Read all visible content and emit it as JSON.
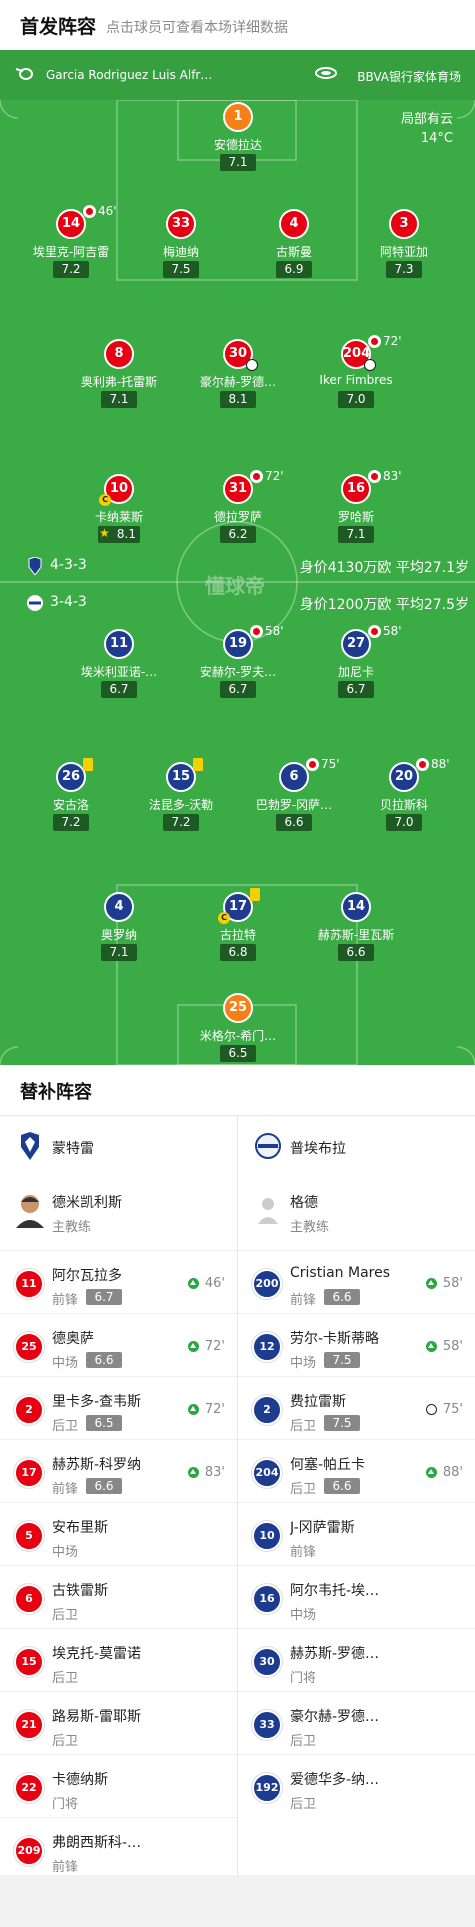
{
  "header": {
    "title": "首发阵容",
    "subtitle": "点击球员可查看本场详细数据"
  },
  "pitch": {
    "referee": "Garcia Rodriguez Luis Alfr…",
    "stadium": "BBVA银行家体育场",
    "weather": "局部有云",
    "temperature": "14°C",
    "watermark": "懂球帝"
  },
  "home_team": {
    "formation": "4-3-3",
    "value": "身价4130万欧 平均27.1岁"
  },
  "away_team": {
    "formation": "3-4-3",
    "value": "身价1200万欧 平均27.5岁"
  },
  "home_players": [
    {
      "num": "1",
      "name": "安德拉达",
      "rating": "7.1",
      "color": "orange"
    },
    {
      "num": "14",
      "name": "埃里克-阿吉雷",
      "rating": "7.2",
      "sub": "46'"
    },
    {
      "num": "33",
      "name": "梅迪纳",
      "rating": "7.5"
    },
    {
      "num": "4",
      "name": "古斯曼",
      "rating": "6.9"
    },
    {
      "num": "3",
      "name": "阿特亚加",
      "rating": "7.3"
    },
    {
      "num": "8",
      "name": "奥利弗-托雷斯",
      "rating": "7.1"
    },
    {
      "num": "30",
      "name": "豪尔赫-罗德…",
      "rating": "8.1"
    },
    {
      "num": "204",
      "name": "Iker Fimbres",
      "rating": "7.0",
      "sub": "72'"
    },
    {
      "num": "10",
      "name": "卡纳莱斯",
      "rating": "8.1"
    },
    {
      "num": "31",
      "name": "德拉罗萨",
      "rating": "6.2",
      "sub": "72'"
    },
    {
      "num": "16",
      "name": "罗哈斯",
      "rating": "7.1",
      "sub": "83'"
    }
  ],
  "away_players": [
    {
      "num": "11",
      "name": "埃米利亚诺-…",
      "rating": "6.7"
    },
    {
      "num": "19",
      "name": "安赫尔-罗夫…",
      "rating": "6.7",
      "sub": "58'"
    },
    {
      "num": "27",
      "name": "加尼卡",
      "rating": "6.7",
      "sub": "58'"
    },
    {
      "num": "26",
      "name": "安古洛",
      "rating": "7.2"
    },
    {
      "num": "15",
      "name": "法昆多-沃勒",
      "rating": "7.2"
    },
    {
      "num": "6",
      "name": "巴勃罗-冈萨…",
      "rating": "6.6",
      "sub": "75'"
    },
    {
      "num": "20",
      "name": "贝拉斯科",
      "rating": "7.0",
      "sub": "88'"
    },
    {
      "num": "4",
      "name": "奥罗纳",
      "rating": "7.1"
    },
    {
      "num": "17",
      "name": "古拉特",
      "rating": "6.8"
    },
    {
      "num": "14",
      "name": "赫苏斯-里瓦斯",
      "rating": "6.6"
    },
    {
      "num": "25",
      "name": "米格尔-希门…",
      "rating": "6.5",
      "color": "orange"
    }
  ],
  "subs": {
    "title": "替补阵容",
    "left_team": "蒙特雷",
    "right_team": "普埃布拉",
    "left_coach": {
      "name": "德米凯利斯",
      "role": "主教练"
    },
    "right_coach": {
      "name": "格德",
      "role": "主教练"
    },
    "left": [
      {
        "num": "11",
        "name": "阿尔瓦拉多",
        "pos": "前锋",
        "rating": "6.7",
        "time": "46'"
      },
      {
        "num": "25",
        "name": "德奥萨",
        "pos": "中场",
        "rating": "6.6",
        "time": "72'"
      },
      {
        "num": "2",
        "name": "里卡多-查韦斯",
        "pos": "后卫",
        "rating": "6.5",
        "time": "72'"
      },
      {
        "num": "17",
        "name": "赫苏斯-科罗纳",
        "pos": "前锋",
        "rating": "6.6",
        "time": "83'"
      },
      {
        "num": "5",
        "name": "安布里斯",
        "pos": "中场"
      },
      {
        "num": "6",
        "name": "古铁雷斯",
        "pos": "后卫"
      },
      {
        "num": "15",
        "name": "埃克托-莫雷诺",
        "pos": "后卫"
      },
      {
        "num": "21",
        "name": "路易斯-雷耶斯",
        "pos": "后卫"
      },
      {
        "num": "22",
        "name": "卡德纳斯",
        "pos": "门将"
      },
      {
        "num": "209",
        "name": "弗朗西斯科-…",
        "pos": "前锋"
      }
    ],
    "right": [
      {
        "num": "200",
        "name": "Cristian Mares",
        "pos": "前锋",
        "rating": "6.6",
        "time": "58'"
      },
      {
        "num": "12",
        "name": "劳尔-卡斯蒂略",
        "pos": "中场",
        "rating": "7.5",
        "time": "58'"
      },
      {
        "num": "2",
        "name": "费拉雷斯",
        "pos": "后卫",
        "rating": "7.5",
        "time": "75'"
      },
      {
        "num": "204",
        "name": "何塞-帕丘卡",
        "pos": "后卫",
        "rating": "6.6",
        "time": "88'"
      },
      {
        "num": "10",
        "name": "J-冈萨雷斯",
        "pos": "前锋"
      },
      {
        "num": "16",
        "name": "阿尔韦托-埃…",
        "pos": "中场"
      },
      {
        "num": "30",
        "name": "赫苏斯-罗德…",
        "pos": "门将"
      },
      {
        "num": "33",
        "name": "豪尔赫-罗德…",
        "pos": "后卫"
      },
      {
        "num": "192",
        "name": "爱德华多-纳…",
        "pos": "后卫"
      }
    ]
  },
  "colors": {
    "pitch": "#3bab45",
    "home": "#e60012",
    "away": "#1d3c8f",
    "gk": "#f77f17",
    "rating_bg": "#1e5a24"
  },
  "icons": [
    "whistle-icon",
    "stadium-icon",
    "sub-out-icon",
    "yellow-card-icon",
    "captain-icon",
    "ball-icon",
    "star-icon",
    "sub-in-icon"
  ]
}
